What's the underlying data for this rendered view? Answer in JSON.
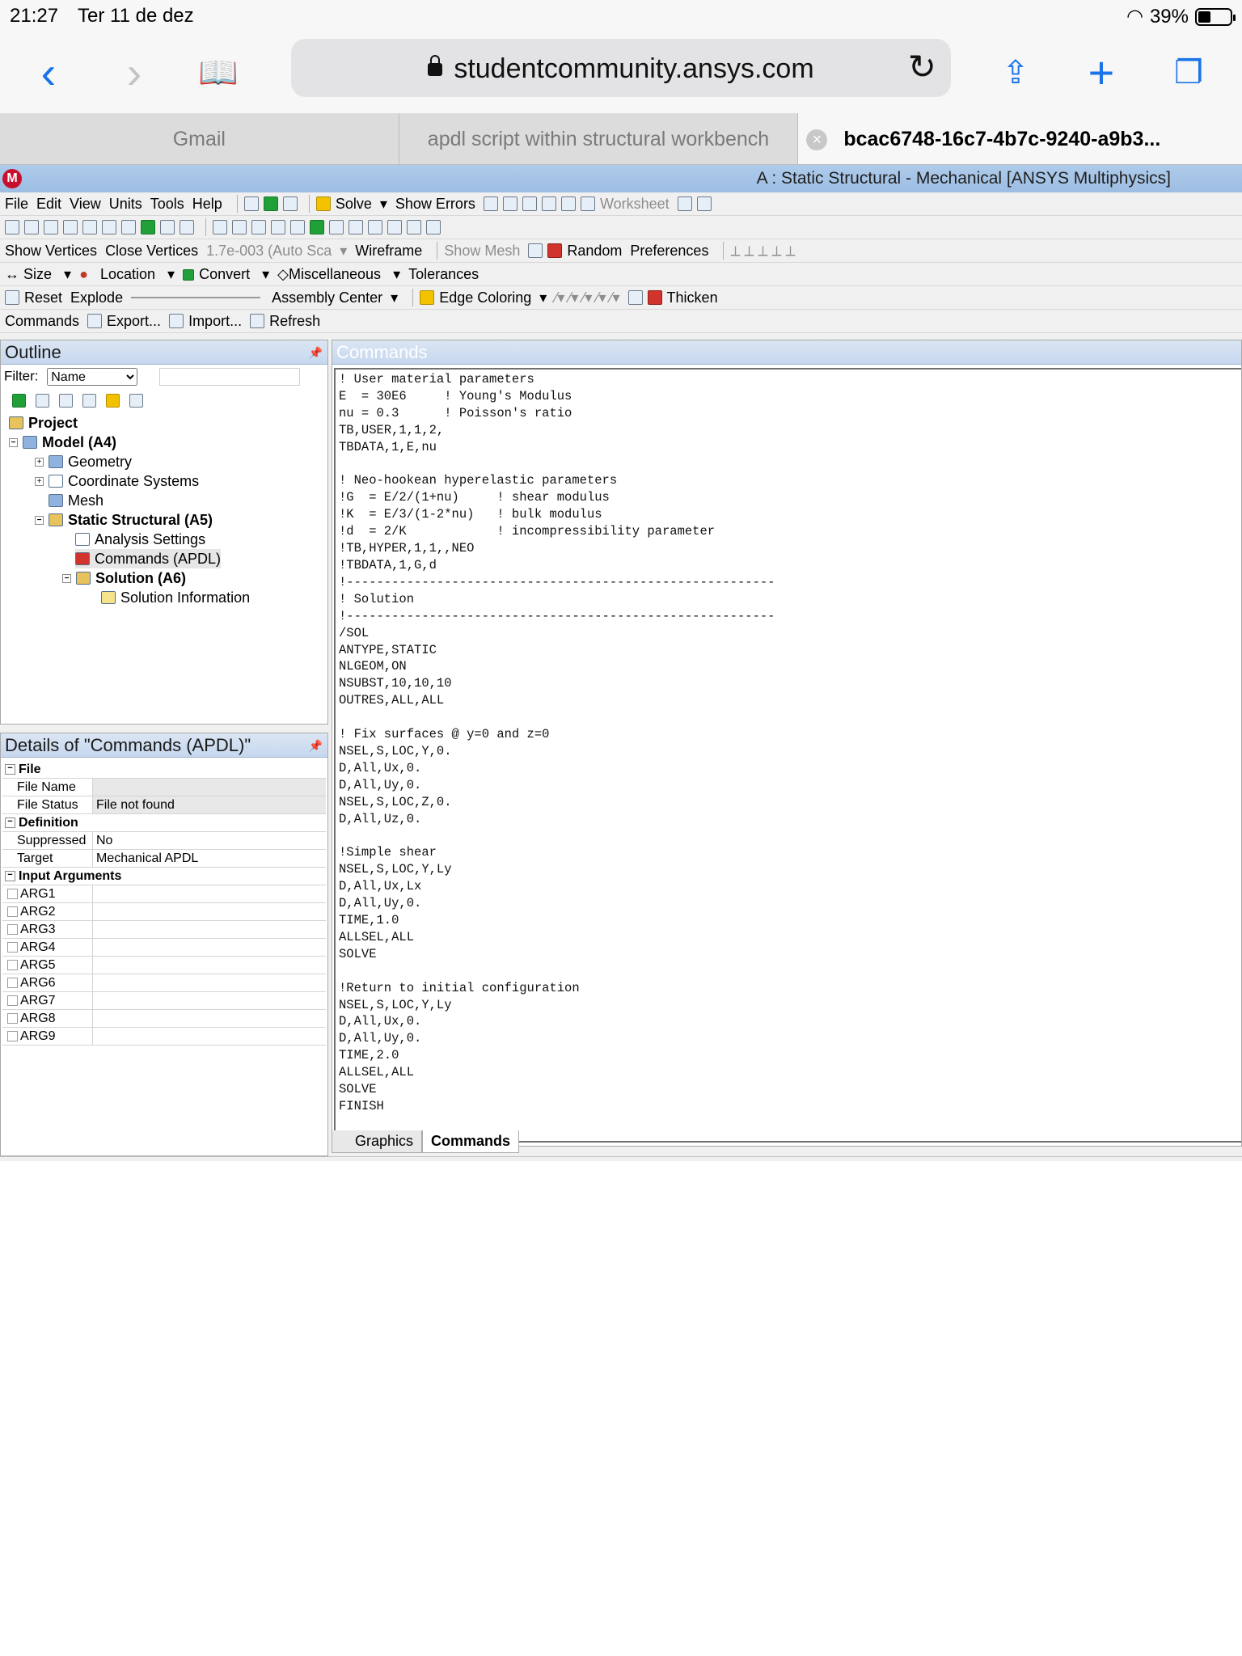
{
  "status_bar": {
    "time": "21:27",
    "date": "Ter 11 de dez",
    "battery": "39%",
    "battery_level": 0.39
  },
  "browser": {
    "url": "studentcommunity.ansys.com",
    "tabs": [
      {
        "label": "Gmail"
      },
      {
        "label": "apdl script within structural workbench"
      },
      {
        "label": "bcac6748-16c7-4b7c-9240-a9b3..."
      }
    ]
  },
  "app": {
    "title": "A : Static Structural - Mechanical [ANSYS Multiphysics]",
    "menu": [
      "File",
      "Edit",
      "View",
      "Units",
      "Tools",
      "Help"
    ],
    "toolbar1": {
      "solve": "Solve",
      "show_errors": "Show Errors",
      "worksheet": "Worksheet"
    },
    "toolbar3": {
      "show_vertices": "Show Vertices",
      "close_vertices": "Close Vertices",
      "scale": "1.7e-003 (Auto Sca",
      "wireframe": "Wireframe",
      "show_mesh": "Show Mesh",
      "random": "Random",
      "preferences": "Preferences"
    },
    "toolbar4": {
      "size": "Size",
      "location": "Location",
      "convert": "Convert",
      "misc": "Miscellaneous",
      "tolerances": "Tolerances"
    },
    "toolbar5": {
      "reset": "Reset",
      "explode": "Explode",
      "assembly": "Assembly Center",
      "edge": "Edge Coloring",
      "thicken": "Thicken"
    },
    "toolbar6": {
      "commands": "Commands",
      "export": "Export...",
      "import": "Import...",
      "refresh": "Refresh"
    }
  },
  "outline": {
    "title": "Outline",
    "filter_label": "Filter:",
    "filter_value": "Name",
    "tree": [
      {
        "label": "Project"
      },
      {
        "label": "Model (A4)"
      },
      {
        "label": "Geometry"
      },
      {
        "label": "Coordinate Systems"
      },
      {
        "label": "Mesh"
      },
      {
        "label": "Static Structural (A5)"
      },
      {
        "label": "Analysis Settings"
      },
      {
        "label": "Commands (APDL)"
      },
      {
        "label": "Solution (A6)"
      },
      {
        "label": "Solution Information"
      }
    ]
  },
  "details": {
    "title": "Details of \"Commands (APDL)\"",
    "sections": {
      "file": "File",
      "file_name": "File Name",
      "file_status": "File Status",
      "file_status_value": "File not found",
      "definition": "Definition",
      "suppressed": "Suppressed",
      "suppressed_value": "No",
      "target": "Target",
      "target_value": "Mechanical APDL",
      "input_args": "Input Arguments"
    },
    "args": [
      "ARG1",
      "ARG2",
      "ARG3",
      "ARG4",
      "ARG5",
      "ARG6",
      "ARG7",
      "ARG8",
      "ARG9"
    ]
  },
  "commands": {
    "title": "Commands",
    "text": "! User material parameters\nE  = 30E6     ! Young's Modulus\nnu = 0.3      ! Poisson's ratio\nTB,USER,1,1,2,\nTBDATA,1,E,nu\n\n! Neo-hookean hyperelastic parameters\n!G  = E/2/(1+nu)     ! shear modulus\n!K  = E/3/(1-2*nu)   ! bulk modulus\n!d  = 2/K            ! incompressibility parameter\n!TB,HYPER,1,1,,NEO\n!TBDATA,1,G,d\n!---------------------------------------------------------\n! Solution\n!---------------------------------------------------------\n/SOL\nANTYPE,STATIC\nNLGEOM,ON\nNSUBST,10,10,10\nOUTRES,ALL,ALL\n\n! Fix surfaces @ y=0 and z=0\nNSEL,S,LOC,Y,0.\nD,All,Ux,0.\nD,All,Uy,0.\nNSEL,S,LOC,Z,0.\nD,All,Uz,0.\n\n!Simple shear\nNSEL,S,LOC,Y,Ly\nD,All,Ux,Lx\nD,All,Uy,0.\nTIME,1.0\nALLSEL,ALL\nSOLVE\n\n!Return to initial configuration\nNSEL,S,LOC,Y,Ly\nD,All,Ux,0.\nD,All,Uy,0.\nTIME,2.0\nALLSEL,ALL\nSOLVE\nFINISH",
    "bottom_tabs": [
      "Graphics",
      "Commands"
    ]
  }
}
